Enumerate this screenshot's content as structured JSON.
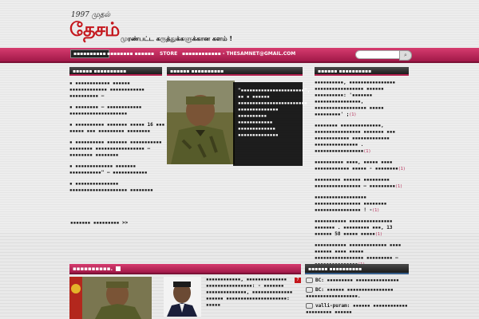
{
  "header": {
    "logo_top": "1997 முதல்",
    "logo_main": "தேசம்",
    "tagline": "முரண்பட்ட கருத்துக்களுக்கான களம் !"
  },
  "nav": {
    "items": [
      "▪▪▪▪▪▪▪▪▪▪",
      "▪▪▪▪▪▪▪▪ ▪▪▪▪▪▪",
      "STORE",
      "▪▪▪▪▪▪▪▪▪▪▪▪ - THESAMNET@GMAIL.COM"
    ]
  },
  "left": {
    "header": "▪▪▪▪▪▪ ▪▪▪▪▪▪▪▪▪▪",
    "items": [
      "▪ ▪▪▪▪▪▪▪▪▪▪▪▪ ▪▪▪▪▪▪ ▪▪▪▪▪▪▪▪▪▪▪▪▪ ▪▪▪▪▪▪▪▪▪▪▪▪ ▪▪▪▪▪▪▪▪▪▪ –",
      "▪ ▪▪▪▪▪▪▪▪ – ▪▪▪▪▪▪▪▪▪▪▪▪ ▪▪▪▪▪▪▪▪▪▪▪▪▪▪▪▪▪▪▪▪",
      "▪ ▪▪▪▪▪▪▪▪▪▪ ▪▪▪▪▪▪▪ ▪▪▪▪▪ 16 ▪▪▪ ▪▪▪▪▪ ▪▪▪ ▪▪▪▪▪▪▪▪▪ ▪▪▪▪▪▪▪▪",
      "▪ ▪▪▪▪▪▪▪▪▪▪ ▪▪▪▪▪▪▪ ▪▪▪▪▪▪▪▪▪▪▪ ▪▪▪▪▪▪▪▪ ▪▪▪▪▪▪▪▪▪▪▪▪▪▪▪▪▪ – ▪▪▪▪▪▪▪▪ ▪▪▪▪▪▪▪▪",
      "▪ ▪▪▪▪▪▪▪▪▪▪▪▪▪ ▪▪▪▪▪▪▪ ▪▪▪▪▪▪▪▪▪▪▪\" – ▪▪▪▪▪▪▪▪▪▪▪▪",
      "▪ ▪▪▪▪▪▪▪▪▪▪▪▪▪▪▪ ▪▪▪▪▪▪▪▪▪▪▪▪▪▪▪▪▪▪▪▪ ▪▪▪▪▪▪▪▪"
    ],
    "more": "▪▪▪▪▪▪▪ ▪▪▪▪▪▪▪▪▪ >>"
  },
  "center": {
    "header": "▪▪▪▪▪▪ ▪▪▪▪▪▪▪▪▪▪",
    "overlay": "\"▪▪▪▪▪▪▪▪▪▪▪▪▪▪▪▪▪▪▪▪▪▪\", ▪▪ ▪ ▪▪▪▪▪▪ ▪▪▪▪▪▪▪▪▪▪▪▪▪▪▪▪▪▪▪▪▪▪▪▪ ▪▪▪▪▪▪▪▪▪▪▪▪▪▪ ▪▪▪▪▪▪▪▪▪▪ ▪▪▪▪▪▪▪▪▪▪▪▪ ▪▪▪▪▪▪▪▪▪▪▪▪▪ ▪▪▪▪▪▪▪▪▪▪▪▪▪▪"
  },
  "right": {
    "header": "▪▪▪▪▪▪ ▪▪▪▪▪▪▪▪▪▪",
    "items": [
      {
        "text": "▪▪▪▪▪▪▪▪▪▪, ▪▪▪▪▪▪▪▪▪▪▪▪▪▪▪▪ ▪▪▪▪▪▪▪▪▪▪▪▪▪▪▪▪▪ ▪▪▪▪▪▪ ▪▪▪▪▪▪▪▪▪▪: '▪▪▪▪▪▪▪ ▪▪▪▪▪▪▪▪▪▪▪▪▪▪▪▪, ▪▪▪▪▪▪▪▪▪▪▪▪▪▪▪▪▪▪ ▪▪▪▪▪ ▪▪▪▪▪▪▪▪▪' ;",
        "count": "(1)"
      },
      {
        "text": "▪▪▪▪▪▪▪▪ ▪▪▪▪▪▪▪▪▪▪▪▪▪▪, ▪▪▪▪▪▪▪▪▪▪▪▪▪▪▪▪ ▪▪▪▪▪▪▪ ▪▪▪ ▪▪▪▪▪▪▪▪▪▪▪▪ ▪▪▪▪▪▪▪▪▪▪▪▪▪ ▪▪▪▪▪▪▪▪▪▪▪▪▪▪▪ . ▪▪▪▪▪▪▪▪▪▪▪▪▪▪▪▪▪",
        "count": "(1)"
      },
      {
        "text": "▪▪▪▪▪▪▪▪▪▪ ▪▪▪▪, ▪▪▪▪▪ ▪▪▪▪ ▪▪▪▪▪▪▪▪▪▪▪▪ ▪▪▪▪▪ - ▪▪▪▪▪▪▪▪",
        "count": "(1)"
      },
      {
        "text": "▪▪▪▪▪▪▪▪▪ ▪▪▪▪▪▪ ▪▪▪▪▪▪▪▪▪ ▪▪▪▪▪▪▪▪▪▪▪▪▪▪▪▪ – ▪▪▪▪▪▪▪▪▪",
        "count": "(1)"
      },
      {
        "text": "▪▪▪▪▪▪▪▪▪▪▪▪▪▪▪▪▪▪ ▪▪▪▪▪▪▪▪▪▪▪▪▪▪▪▪ ▪▪▪▪▪▪▪▪ ▪▪▪▪▪▪▪▪▪▪▪▪▪▪▪▪ ! -",
        "count": "(1)"
      },
      {
        "text": "▪▪▪▪▪▪▪▪▪▪▪ ▪▪▪▪▪▪▪▪▪▪▪▪▪▪▪ ▪▪▪▪▪▪▪ . ▪▪▪▪▪▪▪▪▪ ▪▪▪, 13 ▪▪▪▪▪▪ 58 ▪▪▪▪▪ ▪▪▪▪▪",
        "count": "(1)"
      },
      {
        "text": "▪▪▪▪▪▪▪▪▪▪▪ ▪▪▪▪▪▪▪▪▪▪▪▪▪ ▪▪▪▪ ▪▪▪▪▪▪ ▪▪▪▪ ▪▪▪▪▪ ▪▪▪▪▪▪▪▪▪▪▪▪▪▪▪▪▪ ▪▪▪▪▪▪▪▪▪ – ▪▪▪▪▪▪▪▪▪▪▪▪▪▪▪",
        "count": "(1)"
      }
    ]
  },
  "bottom": {
    "pink_header": "▪▪▪▪▪▪▪▪▪▪.",
    "article_text": "▪▪▪▪▪▪▪▪▪▪▪▪, ▪▪▪▪▪▪▪▪▪▪▪▪▪▪ ▪▪▪▪▪▪▪▪▪▪▪▪▪▪▪▪: - ▪▪▪▪▪▪▪ ▪▪▪▪▪▪▪▪▪▪▪▪▪▪, ▪▪▪▪▪▪▪▪▪▪▪▪▪▪ ▪▪▪▪▪▪ ▪▪▪▪▪▪▪▪▪▪▪▪▪▪▪▪▪▪▪▪▪: ▪▪▪▪▪",
    "badge": "7",
    "comments_header": "▪▪▪▪▪▪ ▪▪▪▪▪▪▪▪▪▪",
    "comments": [
      {
        "author": "BC:",
        "text": "▪▪▪▪▪▪▪▪▪ ▪▪▪▪▪▪▪▪▪▪▪▪▪▪▪"
      },
      {
        "author": "BC:",
        "text": "▪▪▪▪▪▪ ▪▪▪▪▪▪▪▪▪▪▪▪▪▪▪▪ ▪▪▪▪▪▪▪▪▪▪▪▪▪▪▪▪▪▪."
      },
      {
        "author": "valli-puram:",
        "text": "▪▪▪▪▪▪ ▪▪▪▪▪▪▪▪▪▪▪▪ ▪▪▪▪▪▪▪▪▪ ▪▪▪▪▪▪"
      }
    ]
  }
}
